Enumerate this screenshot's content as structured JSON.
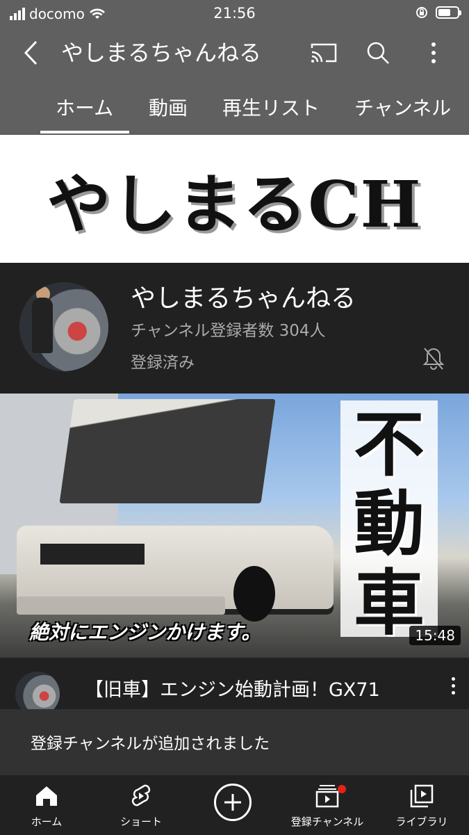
{
  "status_bar": {
    "carrier": "docomo",
    "time": "21:56",
    "battery_percent": 65
  },
  "app_bar": {
    "title": "やしまるちゃんねる",
    "icons": [
      "back-icon",
      "cast-icon",
      "search-icon",
      "more-icon"
    ]
  },
  "tabs": [
    {
      "label": "ホーム",
      "selected": true
    },
    {
      "label": "動画",
      "selected": false
    },
    {
      "label": "再生リスト",
      "selected": false
    },
    {
      "label": "チャンネル",
      "selected": false
    }
  ],
  "banner": {
    "text": "やしまるCH"
  },
  "channel": {
    "name": "やしまるちゃんねる",
    "subscribers": "チャンネル登録者数 304人",
    "status": "登録済み"
  },
  "video": {
    "thumbnail_caption": "絶対にエンジンかけます。",
    "thumbnail_vertical_text": [
      "不",
      "動",
      "車"
    ],
    "duration": "15:48",
    "title": "【旧車】エンジン始動計画！GX71"
  },
  "snackbar": {
    "message": "登録チャンネルが追加されました"
  },
  "bottom_nav": [
    {
      "label": "ホーム",
      "icon": "home-icon"
    },
    {
      "label": "ショート",
      "icon": "shorts-icon"
    },
    {
      "label": "",
      "icon": "create-icon"
    },
    {
      "label": "登録チャンネル",
      "icon": "subscriptions-icon"
    },
    {
      "label": "ライブラリ",
      "icon": "library-icon"
    }
  ]
}
